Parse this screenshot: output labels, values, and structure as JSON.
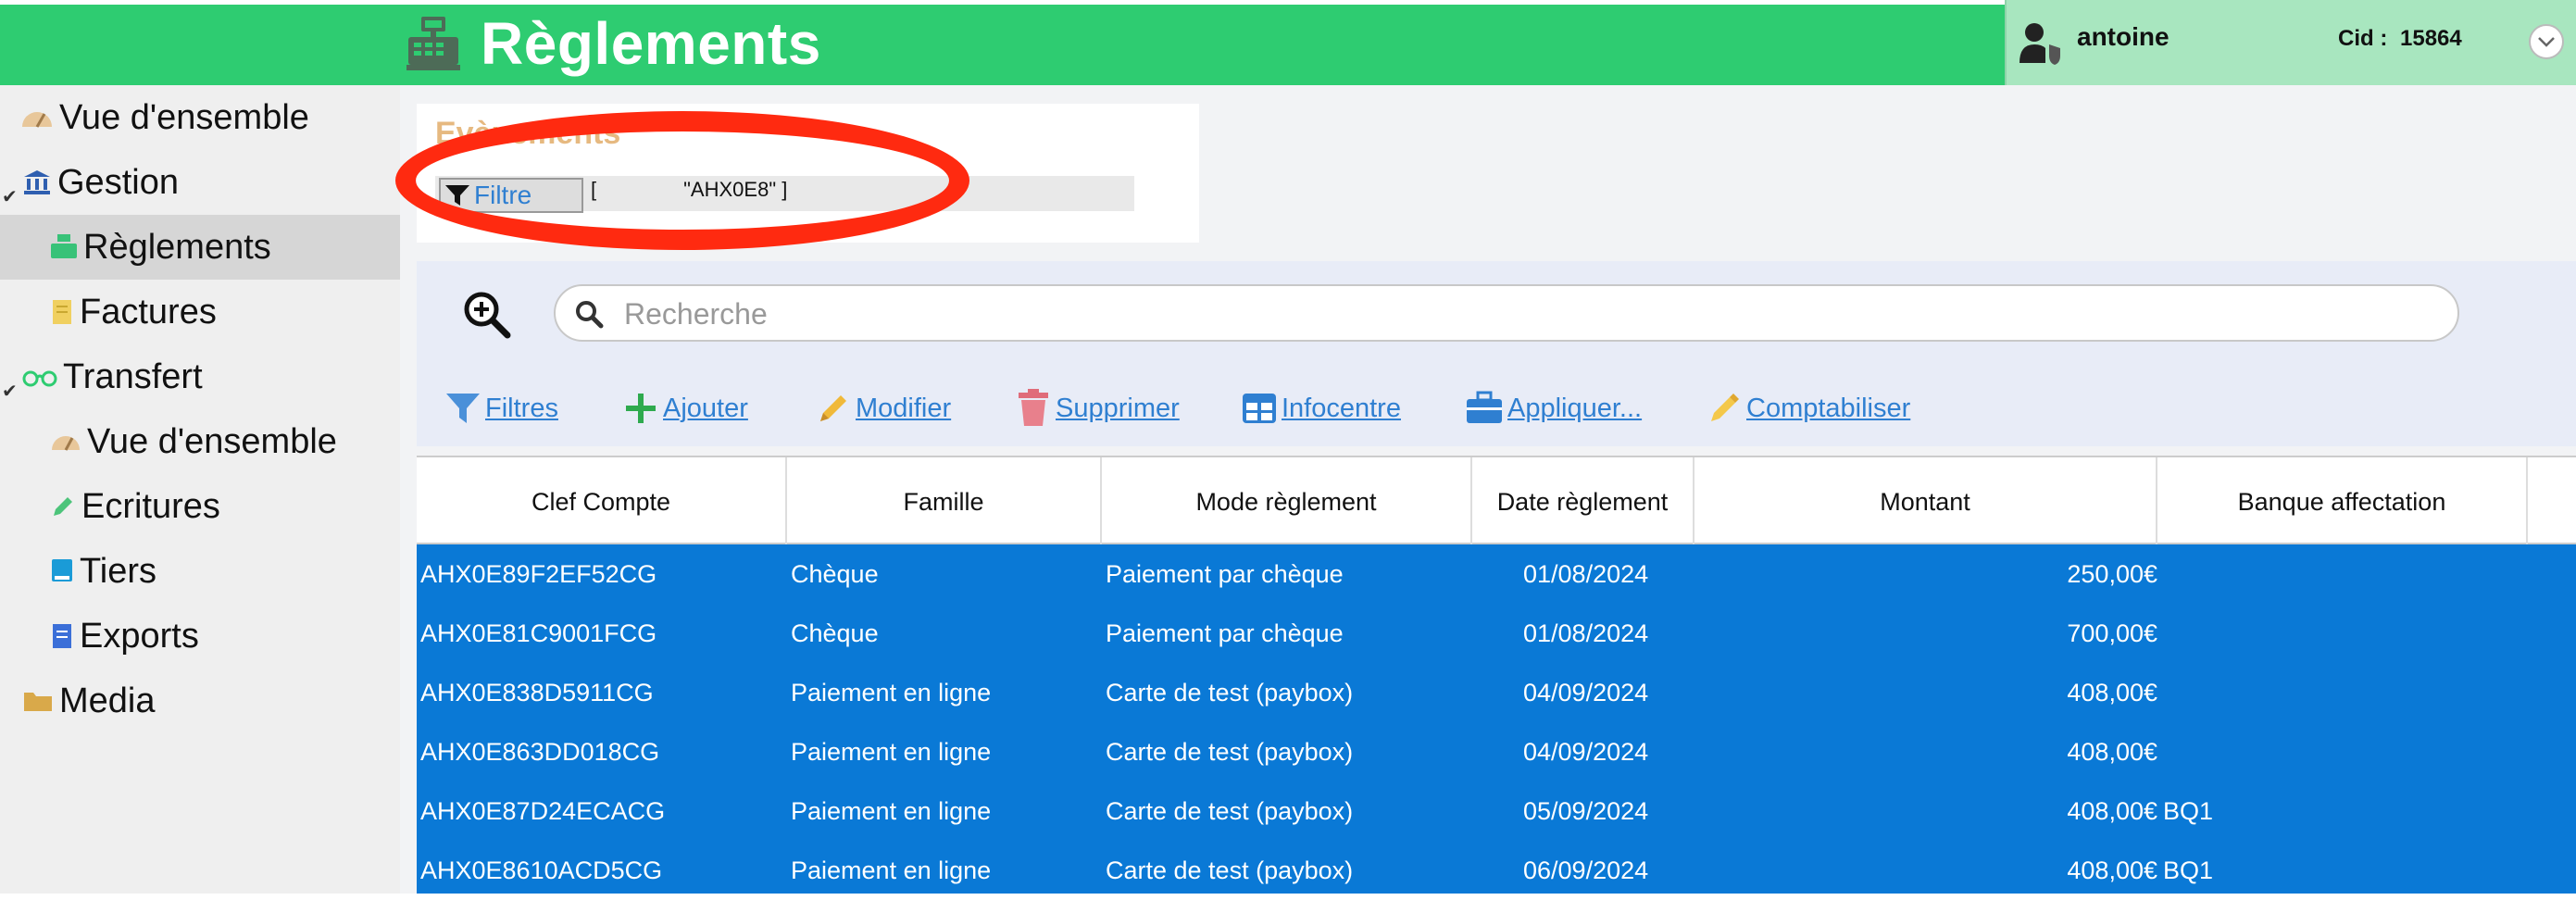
{
  "header": {
    "title": "Règlements",
    "user_name": "antoine",
    "cid_label": "Cid :",
    "cid_value": "15864"
  },
  "sidebar": {
    "items": [
      {
        "label": "Vue d'ensemble",
        "icon": "dashboard-icon"
      },
      {
        "label": "Gestion",
        "icon": "bank-icon"
      },
      {
        "label": "Règlements",
        "icon": "cash-register-icon"
      },
      {
        "label": "Factures",
        "icon": "document-icon"
      },
      {
        "label": "Transfert",
        "icon": "glasses-icon"
      },
      {
        "label": "Vue d'ensemble",
        "icon": "dashboard-icon"
      },
      {
        "label": "Ecritures",
        "icon": "pencil-icon"
      },
      {
        "label": "Tiers",
        "icon": "book-icon"
      },
      {
        "label": "Exports",
        "icon": "file-icon"
      },
      {
        "label": "Media",
        "icon": "folder-icon"
      }
    ]
  },
  "events": {
    "title": "Evènements",
    "filter_label": "Filtre",
    "filter_open": "[",
    "filter_value": "\"AHX0E8\" ]"
  },
  "search": {
    "placeholder": "Recherche"
  },
  "toolbar": {
    "filters": "Filtres",
    "add": "Ajouter",
    "edit": "Modifier",
    "delete": "Supprimer",
    "infocentre": "Infocentre",
    "apply": "Appliquer...",
    "post": "Comptabiliser"
  },
  "table": {
    "columns": [
      "Clef Compte",
      "Famille",
      "Mode règlement",
      "Date règlement",
      "Montant",
      "Banque affectation"
    ],
    "rows": [
      [
        "AHX0E89F2EF52CG",
        "Chèque",
        "Paiement par chèque",
        "01/08/2024",
        "250,00€",
        ""
      ],
      [
        "AHX0E81C9001FCG",
        "Chèque",
        "Paiement par chèque",
        "01/08/2024",
        "700,00€",
        ""
      ],
      [
        "AHX0E838D5911CG",
        "Paiement en ligne",
        "Carte de test (paybox)",
        "04/09/2024",
        "408,00€",
        ""
      ],
      [
        "AHX0E863DD018CG",
        "Paiement en ligne",
        "Carte de test (paybox)",
        "04/09/2024",
        "408,00€",
        ""
      ],
      [
        "AHX0E87D24ECACG",
        "Paiement en ligne",
        "Carte de test (paybox)",
        "05/09/2024",
        "408,00€",
        "BQ1"
      ],
      [
        "AHX0E8610ACD5CG",
        "Paiement en ligne",
        "Carte de test (paybox)",
        "06/09/2024",
        "408,00€",
        "BQ1"
      ]
    ]
  },
  "colors": {
    "header_green": "#2ecc71",
    "selected_row": "#0a79d6",
    "link_blue": "#2f7fd1",
    "annotation_red": "#ff2a10"
  }
}
